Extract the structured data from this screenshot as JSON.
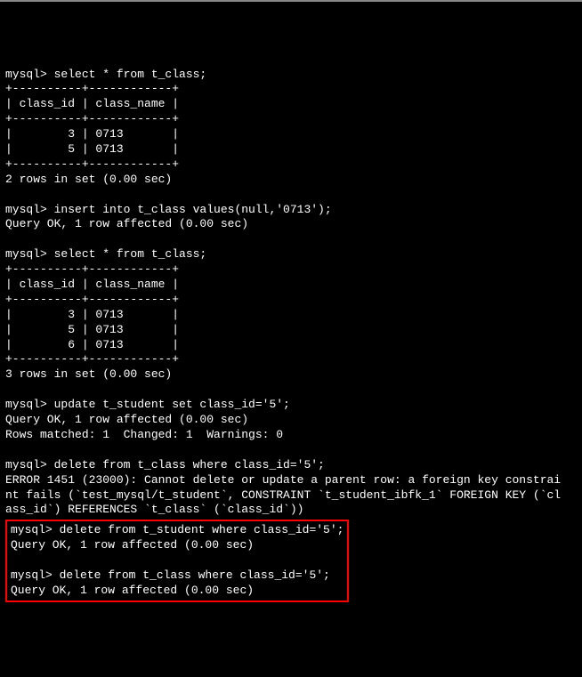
{
  "terminal": {
    "block1": {
      "prompt1": "mysql> select * from t_class;",
      "sep1": "+----------+------------+",
      "header": "| class_id | class_name |",
      "sep2": "+----------+------------+",
      "row1": "|        3 | 0713       |",
      "row2": "|        5 | 0713       |",
      "sep3": "+----------+------------+",
      "result": "2 rows in set (0.00 sec)"
    },
    "block2": {
      "prompt": "mysql> insert into t_class values(null,'0713');",
      "result": "Query OK, 1 row affected (0.00 sec)"
    },
    "block3": {
      "prompt": "mysql> select * from t_class;",
      "sep1": "+----------+------------+",
      "header": "| class_id | class_name |",
      "sep2": "+----------+------------+",
      "row1": "|        3 | 0713       |",
      "row2": "|        5 | 0713       |",
      "row3": "|        6 | 0713       |",
      "sep3": "+----------+------------+",
      "result": "3 rows in set (0.00 sec)"
    },
    "block4": {
      "prompt": "mysql> update t_student set class_id='5';",
      "result1": "Query OK, 1 row affected (0.00 sec)",
      "result2": "Rows matched: 1  Changed: 1  Warnings: 0"
    },
    "block5": {
      "prompt": "mysql> delete from t_class where class_id='5';",
      "error1": "ERROR 1451 (23000): Cannot delete or update a parent row: a foreign key constrai",
      "error2": "nt fails (`test_mysql/t_student`, CONSTRAINT `t_student_ibfk_1` FOREIGN KEY (`cl",
      "error3": "ass_id`) REFERENCES `t_class` (`class_id`))"
    },
    "block6": {
      "prompt1": "mysql> delete from t_student where class_id='5';",
      "result1": "Query OK, 1 row affected (0.00 sec)",
      "blank": "",
      "prompt2": "mysql> delete from t_class where class_id='5';",
      "result2": "Query OK, 1 row affected (0.00 sec)"
    }
  }
}
